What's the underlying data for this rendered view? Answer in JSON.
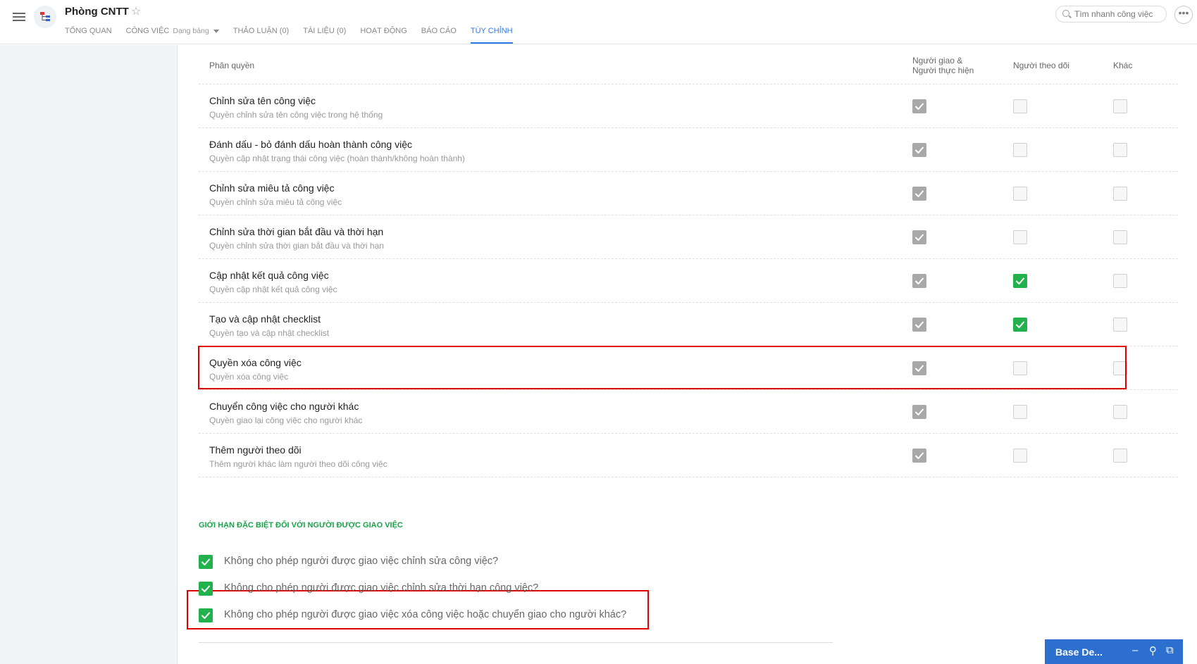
{
  "header": {
    "title": "Phòng CNTT",
    "tabs": [
      {
        "label": "TỔNG QUAN"
      },
      {
        "label": "CÔNG VIỆC",
        "sub": "Dạng bảng"
      },
      {
        "label": "THẢO LUẬN (0)"
      },
      {
        "label": "TÀI LIỆU (0)"
      },
      {
        "label": "HOẠT ĐỘNG"
      },
      {
        "label": "BÁO CÁO"
      },
      {
        "label": "TÙY CHỈNH"
      }
    ],
    "active_tab": "TÙY CHỈNH",
    "search_placeholder": "Tìm nhanh công việc",
    "more_label": "•••"
  },
  "permissions": {
    "header": {
      "col_name": "Phân quyền",
      "col1_line1": "Người giao &",
      "col1_line2": "Người thực hiện",
      "col2": "Người theo dõi",
      "col3": "Khác"
    },
    "rows": [
      {
        "title": "Chỉnh sửa tên công việc",
        "desc": "Quyền chỉnh sửa tên công việc trong hệ thống",
        "c1": "gray",
        "c2": "off",
        "c3": "off"
      },
      {
        "title": "Đánh dấu - bỏ đánh dấu hoàn thành công việc",
        "desc": "Quyền cập nhật trạng thái công việc (hoàn thành/không hoàn thành)",
        "c1": "gray",
        "c2": "off",
        "c3": "off"
      },
      {
        "title": "Chỉnh sửa miêu tả công việc",
        "desc": "Quyền chỉnh sửa miêu tả công việc",
        "c1": "gray",
        "c2": "off",
        "c3": "off"
      },
      {
        "title": "Chỉnh sửa thời gian bắt đầu và thời hạn",
        "desc": "Quyền chỉnh sửa thời gian bắt đầu và thời hạn",
        "c1": "gray",
        "c2": "off",
        "c3": "off"
      },
      {
        "title": "Cập nhật kết quả công việc",
        "desc": "Quyền cập nhật kết quả công việc",
        "c1": "gray",
        "c2": "green",
        "c3": "off"
      },
      {
        "title": "Tạo và cập nhật checklist",
        "desc": "Quyền tạo và cập nhật checklist",
        "c1": "gray",
        "c2": "green",
        "c3": "off"
      },
      {
        "title": "Quyền xóa công việc",
        "desc": "Quyền xóa công việc",
        "c1": "gray",
        "c2": "off",
        "c3": "off"
      },
      {
        "title": "Chuyển công việc cho người khác",
        "desc": "Quyền giao lại công việc cho người khác",
        "c1": "gray",
        "c2": "off",
        "c3": "off"
      },
      {
        "title": "Thêm người theo dõi",
        "desc": "Thêm người khác làm người theo dõi công việc",
        "c1": "gray",
        "c2": "off",
        "c3": "off"
      }
    ]
  },
  "restrictions": {
    "title": "GIỚI HẠN ĐẶC BIỆT ĐỐI VỚI NGƯỜI ĐƯỢC GIAO VIỆC",
    "options": [
      {
        "label": "Không cho phép người được giao việc chỉnh sửa công việc?",
        "checked": true
      },
      {
        "label": "Không cho phép người được giao việc chỉnh sửa thời hạn công việc?",
        "checked": true
      },
      {
        "label": "Không cho phép người được giao việc xóa công việc hoặc chuyển giao cho người khác?",
        "checked": true
      }
    ]
  },
  "chat_widget": {
    "label": "Base De..."
  },
  "colors": {
    "accent_blue": "#2d7be5",
    "check_green": "#22b14c",
    "check_gray": "#a8a8a8",
    "highlight_red": "#e00000",
    "section_green": "#1aa24a"
  }
}
